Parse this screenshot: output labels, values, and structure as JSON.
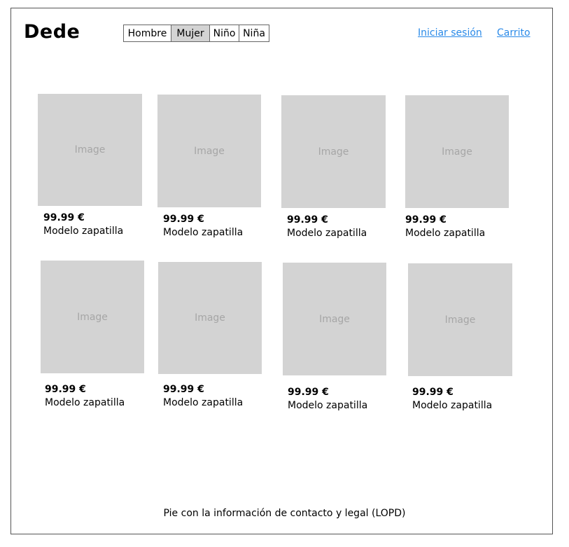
{
  "header": {
    "logo": "Dede",
    "tabs": [
      {
        "label": "Hombre"
      },
      {
        "label": "Mujer",
        "active": true
      },
      {
        "label": "Niño"
      },
      {
        "label": "Niña"
      }
    ],
    "login_link": "Iniciar sesión",
    "cart_link": "Carrito"
  },
  "products": [
    {
      "image_label": "Image",
      "price": "99.99 €",
      "name": "Modelo zapatilla"
    },
    {
      "image_label": "Image",
      "price": "99.99 €",
      "name": "Modelo zapatilla"
    },
    {
      "image_label": "Image",
      "price": "99.99 €",
      "name": "Modelo zapatilla"
    },
    {
      "image_label": "Image",
      "price": "99.99 €",
      "name": "Modelo zapatilla"
    },
    {
      "image_label": "Image",
      "price": "99.99 €",
      "name": "Modelo zapatilla"
    },
    {
      "image_label": "Image",
      "price": "99.99 €",
      "name": "Modelo zapatilla"
    },
    {
      "image_label": "Image",
      "price": "99.99 €",
      "name": "Modelo zapatilla"
    },
    {
      "image_label": "Image",
      "price": "99.99 €",
      "name": "Modelo zapatilla"
    }
  ],
  "footer": {
    "text": "Pie con la información de contacto y legal (LOPD)"
  },
  "colors": {
    "link": "#2a8ae8",
    "placeholder_bg": "#d3d3d3",
    "active_tab_bg": "#d3d3d3"
  }
}
